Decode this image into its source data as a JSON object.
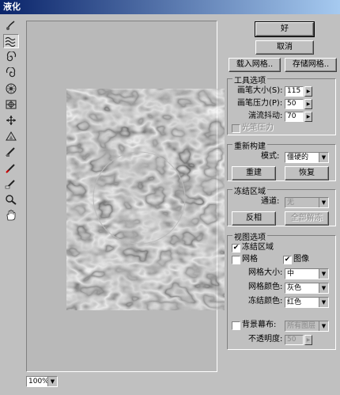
{
  "window": {
    "title": "液化"
  },
  "tools": [
    {
      "name": "warp-icon",
      "selected": false
    },
    {
      "name": "turbulence-icon",
      "selected": true
    },
    {
      "name": "twirl-clockwise-icon",
      "selected": false
    },
    {
      "name": "twirl-counterclockwise-icon",
      "selected": false
    },
    {
      "name": "pucker-icon",
      "selected": false
    },
    {
      "name": "bloat-icon",
      "selected": false
    },
    {
      "name": "shift-pixels-icon",
      "selected": false
    },
    {
      "name": "reflection-icon",
      "selected": false
    },
    {
      "name": "reconstruct-icon",
      "selected": false
    },
    {
      "name": "freeze-icon",
      "selected": false
    },
    {
      "name": "thaw-icon",
      "selected": false
    },
    {
      "name": "zoom-icon",
      "selected": false
    },
    {
      "name": "hand-icon",
      "selected": false
    }
  ],
  "zoom": {
    "value": "100%"
  },
  "buttons": {
    "ok": "好",
    "cancel": "取消",
    "load_mesh": "载入网格..",
    "save_mesh": "存储网格.."
  },
  "tool_options": {
    "title": "工具选项",
    "brush_size_label": "画笔大小(S):",
    "brush_size_value": "115",
    "brush_pressure_label": "画笔压力(P):",
    "brush_pressure_value": "50",
    "turbulent_jitter_label": "湍流抖动:",
    "turbulent_jitter_value": "70",
    "stylus_pressure_label": "光笔压力",
    "stylus_pressure_checked": false
  },
  "reconstruction": {
    "title": "重新构建",
    "mode_label": "模式:",
    "mode_value": "僵硬的",
    "reconstruct_button": "重建",
    "revert_button": "恢复"
  },
  "freeze_area": {
    "title": "冻结区域",
    "channel_label": "通道:",
    "channel_value": "无",
    "invert_button": "反相",
    "thaw_all_button": "全部解冻"
  },
  "view_options": {
    "title": "视图选项",
    "frozen_areas_label": "冻结区域",
    "frozen_areas_checked": true,
    "mesh_label": "网格",
    "mesh_checked": false,
    "image_label": "图像",
    "image_checked": true,
    "mesh_size_label": "网格大小:",
    "mesh_size_value": "中",
    "mesh_color_label": "网格颜色:",
    "mesh_color_value": "灰色",
    "freeze_color_label": "冻结颜色:",
    "freeze_color_value": "红色",
    "backdrop_label": "背景幕布:",
    "backdrop_checked": false,
    "backdrop_value": "所有图层",
    "opacity_label": "不透明度:",
    "opacity_value": "50"
  }
}
